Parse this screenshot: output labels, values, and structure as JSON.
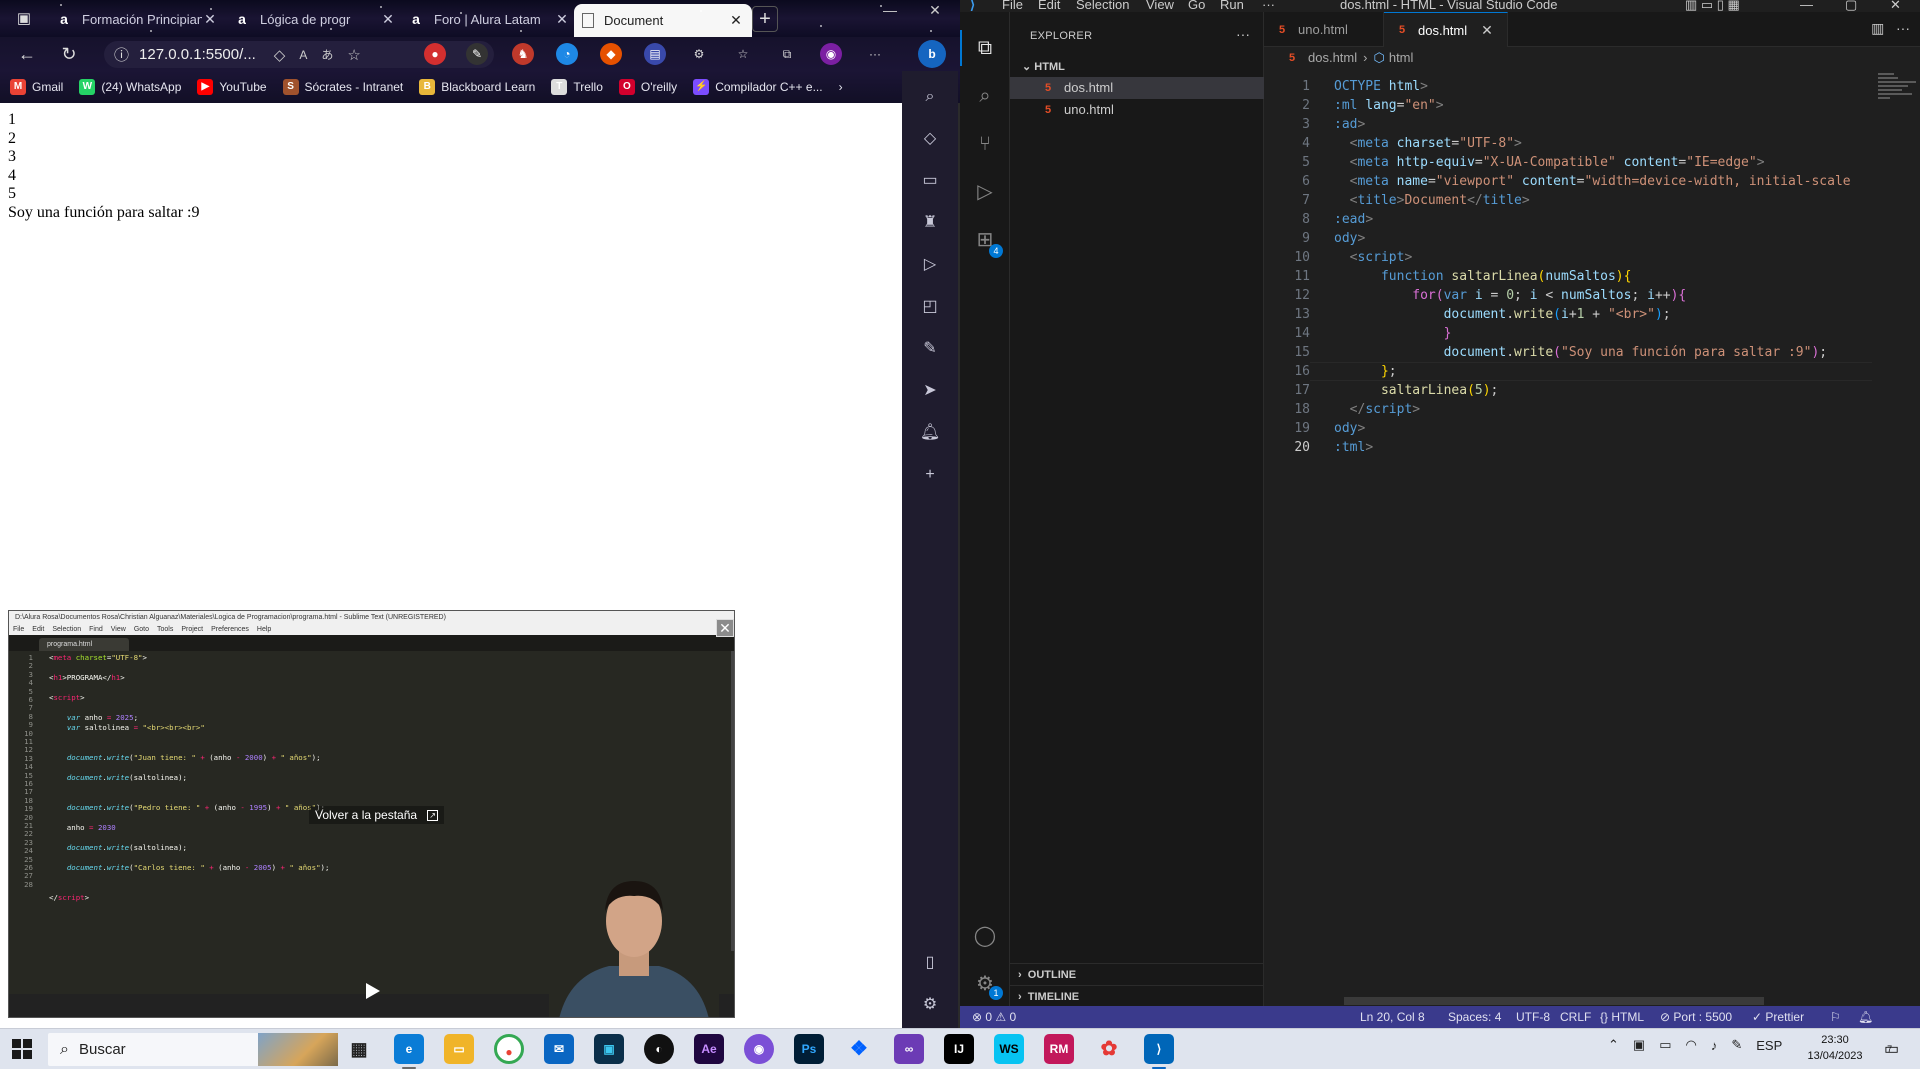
{
  "browser": {
    "tabs": [
      {
        "title": "Formación Principian",
        "icon": "alura-a"
      },
      {
        "title": "Lógica de progr",
        "icon": "alura-a"
      },
      {
        "title": "Foro | Alura Latam",
        "icon": "alura-a"
      },
      {
        "title": "Document",
        "icon": "page-icon",
        "active": true
      }
    ],
    "url": "127.0.0.1:5500/...",
    "bookmarks": [
      {
        "label": "Gmail",
        "icon": "M",
        "color": "#ea4335"
      },
      {
        "label": "(24) WhatsApp",
        "icon": "W",
        "color": "#25d366"
      },
      {
        "label": "YouTube",
        "icon": "▶",
        "color": "#ff0000"
      },
      {
        "label": "Sócrates - Intranet",
        "icon": "S",
        "color": "#a0522d"
      },
      {
        "label": "Blackboard Learn",
        "icon": "B",
        "color": "#e8b73a"
      },
      {
        "label": "Trello",
        "icon": "T",
        "color": "#dddddd"
      },
      {
        "label": "O'reilly",
        "icon": "O",
        "color": "#d3002d"
      },
      {
        "label": "Compilador C++ e...",
        "icon": "⚡",
        "color": "#7c4dff"
      }
    ],
    "page_output": [
      "1",
      "2",
      "3",
      "4",
      "5",
      "Soy una función para saltar :9"
    ],
    "pip": {
      "title": "D:\\Alura Rosa\\Documentos Rosa\\Christian Alguanaz\\Materiales\\Logica de Programacion\\programa.html - Sublime Text (UNREGISTERED)",
      "menu": [
        "File",
        "Edit",
        "Selection",
        "Find",
        "View",
        "Goto",
        "Tools",
        "Project",
        "Preferences",
        "Help"
      ],
      "tab": "programa.html",
      "back_label": "Volver a la pestaña",
      "line_numbers": [
        "1",
        "2",
        "3",
        "4",
        "5",
        "6",
        "7",
        "8",
        "9",
        "10",
        "11",
        "12",
        "13",
        "14",
        "15",
        "16",
        "17",
        "18",
        "19",
        "20",
        "21",
        "22",
        "23",
        "24",
        "25",
        "26",
        "27",
        "28"
      ]
    }
  },
  "vscode": {
    "menu": [
      "File",
      "Edit",
      "Selection",
      "View",
      "Go",
      "Run",
      "···"
    ],
    "window_title": "dos.html - HTML - Visual Studio Code",
    "explorer_title": "EXPLORER",
    "folder": "HTML",
    "files": [
      "dos.html",
      "uno.html"
    ],
    "sections": [
      "OUTLINE",
      "TIMELINE"
    ],
    "editor_tabs": [
      {
        "label": "uno.html"
      },
      {
        "label": "dos.html",
        "active": true
      }
    ],
    "breadcrumb": [
      "dos.html",
      "html"
    ],
    "line_numbers": [
      "1",
      "2",
      "3",
      "4",
      "5",
      "6",
      "7",
      "8",
      "9",
      "10",
      "11",
      "12",
      "13",
      "14",
      "15",
      "16",
      "17",
      "18",
      "19",
      "20"
    ],
    "extensions_badge": "4",
    "settings_badge": "1",
    "status": {
      "problems": "⊗ 0 ⚠ 0",
      "position": "Ln 20, Col 8",
      "spaces": "Spaces: 4",
      "encoding": "UTF-8",
      "eol": "CRLF",
      "language": "{} HTML",
      "port": "⊘ Port : 5500",
      "prettier": "✓ Prettier"
    }
  },
  "taskbar": {
    "search_placeholder": "Buscar",
    "language": "ESP",
    "time": "23:30",
    "date": "13/04/2023",
    "notifications": "7"
  }
}
